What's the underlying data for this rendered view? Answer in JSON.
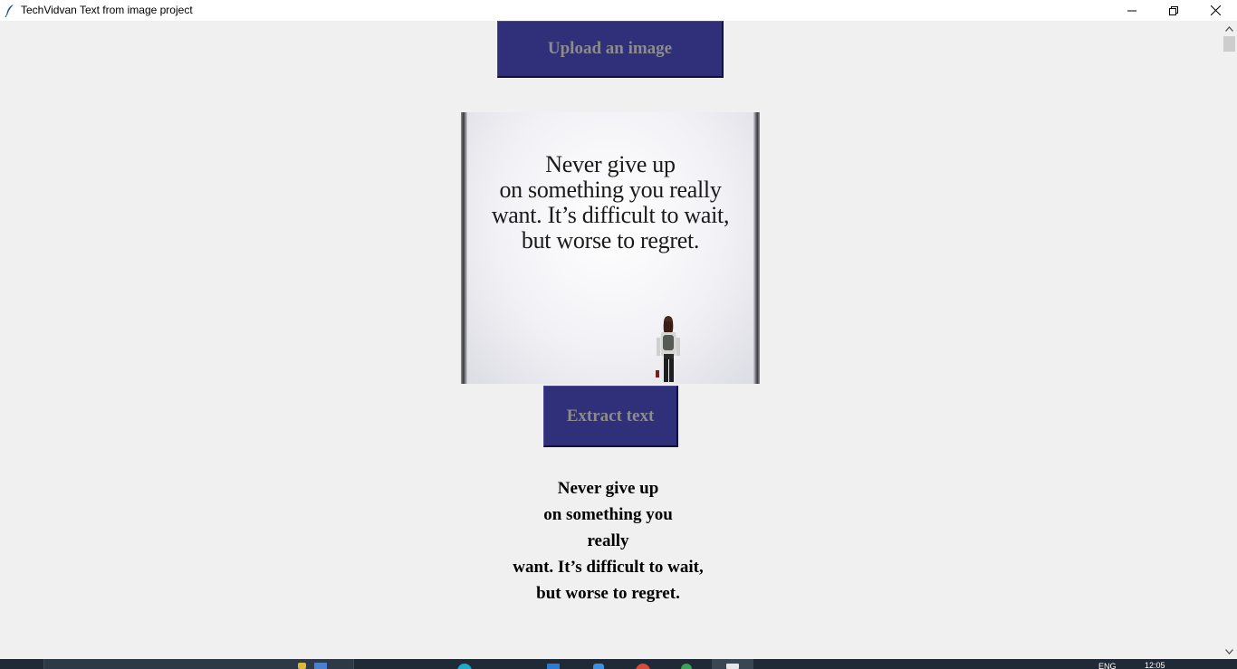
{
  "window": {
    "title": "TechVidvan Text from image project",
    "icons": {
      "app": "feather-icon",
      "minimize": "minimize-icon",
      "maximize": "restore-icon",
      "close": "close-icon"
    }
  },
  "buttons": {
    "upload_label": "Upload an image",
    "extract_label": "Extract text"
  },
  "image": {
    "quote_lines": [
      "Never give up",
      "on something you really",
      "want. It’s difficult to wait,",
      "but worse to regret."
    ]
  },
  "extracted_text": {
    "lines": [
      "Never give up",
      "on something you",
      "really",
      "want. It’s difficult to wait,",
      "but worse to regret."
    ]
  },
  "taskbar": {
    "language": "ENG",
    "time": "12:05"
  },
  "colors": {
    "button_bg": "#2f2f7a",
    "button_text": "#8c8c8c",
    "window_bg": "#f0f0f0"
  }
}
